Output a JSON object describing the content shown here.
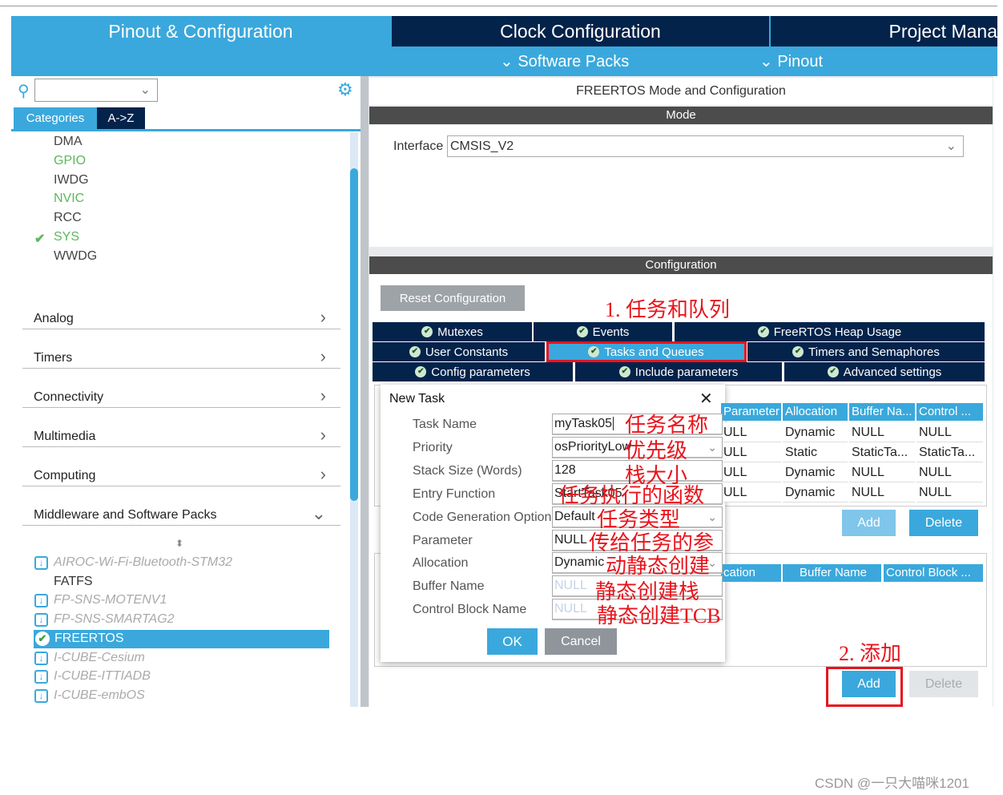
{
  "header": {
    "tabs": [
      {
        "label": "Pinout & Configuration",
        "active": true
      },
      {
        "label": "Clock Configuration"
      },
      {
        "label": "Project Mana"
      }
    ],
    "sub": [
      "Software Packs",
      "Pinout"
    ]
  },
  "left": {
    "tabs": [
      "Categories",
      "A->Z"
    ],
    "system_items": [
      {
        "label": "DMA",
        "color": "#444"
      },
      {
        "label": "GPIO",
        "color": "#5cb85c"
      },
      {
        "label": "IWDG",
        "color": "#444"
      },
      {
        "label": "NVIC",
        "color": "#5cb85c"
      },
      {
        "label": "RCC",
        "color": "#444"
      },
      {
        "label": "SYS",
        "color": "#5cb85c",
        "checked": true
      },
      {
        "label": "WWDG",
        "color": "#444"
      }
    ],
    "sections": [
      "Analog",
      "Timers",
      "Connectivity",
      "Multimedia",
      "Computing",
      "Middleware and Software Packs"
    ],
    "middleware": [
      {
        "label": "AIROC-Wi-Fi-Bluetooth-STM32",
        "type": "pack"
      },
      {
        "label": "FATFS",
        "type": "normal"
      },
      {
        "label": "FP-SNS-MOTENV1",
        "type": "pack"
      },
      {
        "label": "FP-SNS-SMARTAG2",
        "type": "pack"
      },
      {
        "label": "FREERTOS",
        "type": "selected"
      },
      {
        "label": "I-CUBE-Cesium",
        "type": "pack"
      },
      {
        "label": "I-CUBE-ITTIADB",
        "type": "pack"
      },
      {
        "label": "I-CUBE-embOS",
        "type": "pack"
      }
    ]
  },
  "right": {
    "title": "FREERTOS Mode and Configuration",
    "mode": "Mode",
    "interface_label": "Interface",
    "interface_value": "CMSIS_V2",
    "configuration": "Configuration",
    "reset": "Reset Configuration",
    "tabs": [
      [
        "Mutexes",
        "Events",
        "FreeRTOS Heap Usage"
      ],
      [
        "User Constants",
        "Tasks and Queues",
        "Timers and Semaphores"
      ],
      [
        "Config parameters",
        "Include parameters",
        "Advanced settings"
      ]
    ],
    "active_tab": "Tasks and Queues",
    "tasks_headers": [
      "Parameter",
      "Allocation",
      "Buffer Na...",
      "Control ..."
    ],
    "tasks_rows": [
      [
        "ULL",
        "Dynamic",
        "NULL",
        "NULL"
      ],
      [
        "ULL",
        "Static",
        "StaticTa...",
        "StaticTa..."
      ],
      [
        "ULL",
        "Dynamic",
        "NULL",
        "NULL"
      ],
      [
        "ULL",
        "Dynamic",
        "NULL",
        "NULL"
      ]
    ],
    "queues_headers": [
      "cation",
      "Buffer Name",
      "Control Block ..."
    ],
    "add": "Add",
    "delete": "Delete"
  },
  "dialog": {
    "title": "New Task",
    "fields": [
      {
        "label": "Task Name",
        "value": "myTask05"
      },
      {
        "label": "Priority",
        "value": "osPriorityLow",
        "dropdown": true
      },
      {
        "label": "Stack Size (Words)",
        "value": "128"
      },
      {
        "label": "Entry Function",
        "value": "StartTask05"
      },
      {
        "label": "Code Generation Option",
        "value": "Default",
        "dropdown": true
      },
      {
        "label": "Parameter",
        "value": "NULL"
      },
      {
        "label": "Allocation",
        "value": "Dynamic",
        "dropdown": true
      },
      {
        "label": "Buffer Name",
        "value": "NULL",
        "placeholder": true
      },
      {
        "label": "Control Block Name",
        "value": "NULL",
        "placeholder": true
      }
    ],
    "ok": "OK",
    "cancel": "Cancel"
  },
  "annotations": {
    "step1": "1. 任务和队列",
    "step2": "2. 添加",
    "fields": [
      "任务名称",
      "优先级",
      "栈大小",
      "任务执行的函数",
      "任务类型",
      "传给任务的参",
      "动静态创建",
      "静态创建栈",
      "静态创建TCB"
    ]
  },
  "watermark": "CSDN @一只大喵咪1201",
  "colors": {
    "accent": "#3aa8dc",
    "navy": "#03234b",
    "annotation": "#e8141c"
  }
}
